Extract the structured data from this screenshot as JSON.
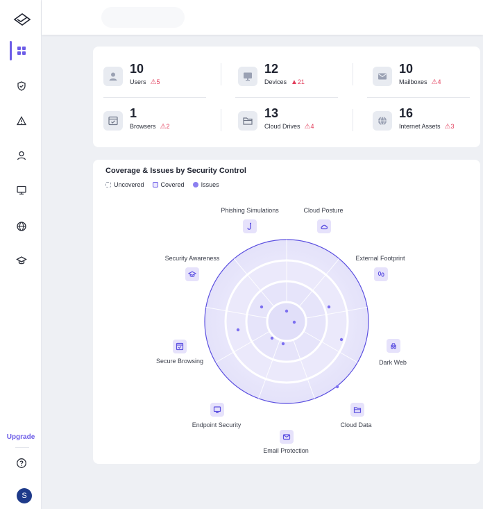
{
  "sidebar": {
    "upgrade_label": "Upgrade",
    "avatar_initial": "S",
    "items": [
      {
        "name": "dashboard",
        "icon": "grid-icon",
        "active": true
      },
      {
        "name": "security",
        "icon": "shield-check-icon"
      },
      {
        "name": "alerts",
        "icon": "warning-icon"
      },
      {
        "name": "users",
        "icon": "user-icon"
      },
      {
        "name": "devices",
        "icon": "monitor-icon"
      },
      {
        "name": "internet",
        "icon": "globe-icon"
      },
      {
        "name": "training",
        "icon": "graduation-cap-icon"
      }
    ]
  },
  "stats": [
    {
      "value": "10",
      "label": "Users",
      "issues": "5",
      "icon": "user-icon"
    },
    {
      "value": "12",
      "label": "Devices",
      "issues": "21",
      "icon": "monitor-icon"
    },
    {
      "value": "10",
      "label": "Mailboxes",
      "issues": "4",
      "icon": "envelope-icon"
    },
    {
      "value": "1",
      "label": "Browsers",
      "issues": "2",
      "icon": "browser-icon"
    },
    {
      "value": "13",
      "label": "Cloud Drives",
      "issues": "4",
      "icon": "folder-icon"
    },
    {
      "value": "16",
      "label": "Internet Assets",
      "issues": "3",
      "icon": "globe-icon"
    }
  ],
  "coverage": {
    "title": "Coverage & Issues by Security Control",
    "legend": {
      "uncovered": "Uncovered",
      "covered": "Covered",
      "issues": "Issues"
    },
    "controls": [
      {
        "label": "Phishing Simulations",
        "icon": "fishhook-icon"
      },
      {
        "label": "Cloud Posture",
        "icon": "cloud-icon"
      },
      {
        "label": "External Footprint",
        "icon": "footprints-icon"
      },
      {
        "label": "Dark Web",
        "icon": "incognito-icon"
      },
      {
        "label": "Cloud Data",
        "icon": "folder-icon"
      },
      {
        "label": "Email Protection",
        "icon": "envelope-icon"
      },
      {
        "label": "Endpoint Security",
        "icon": "monitor-icon"
      },
      {
        "label": "Secure Browsing",
        "icon": "browser-icon"
      },
      {
        "label": "Security Awareness",
        "icon": "graduation-cap-icon"
      }
    ]
  },
  "colors": {
    "accent": "#6c5ce7",
    "warning": "#e23d5b"
  }
}
